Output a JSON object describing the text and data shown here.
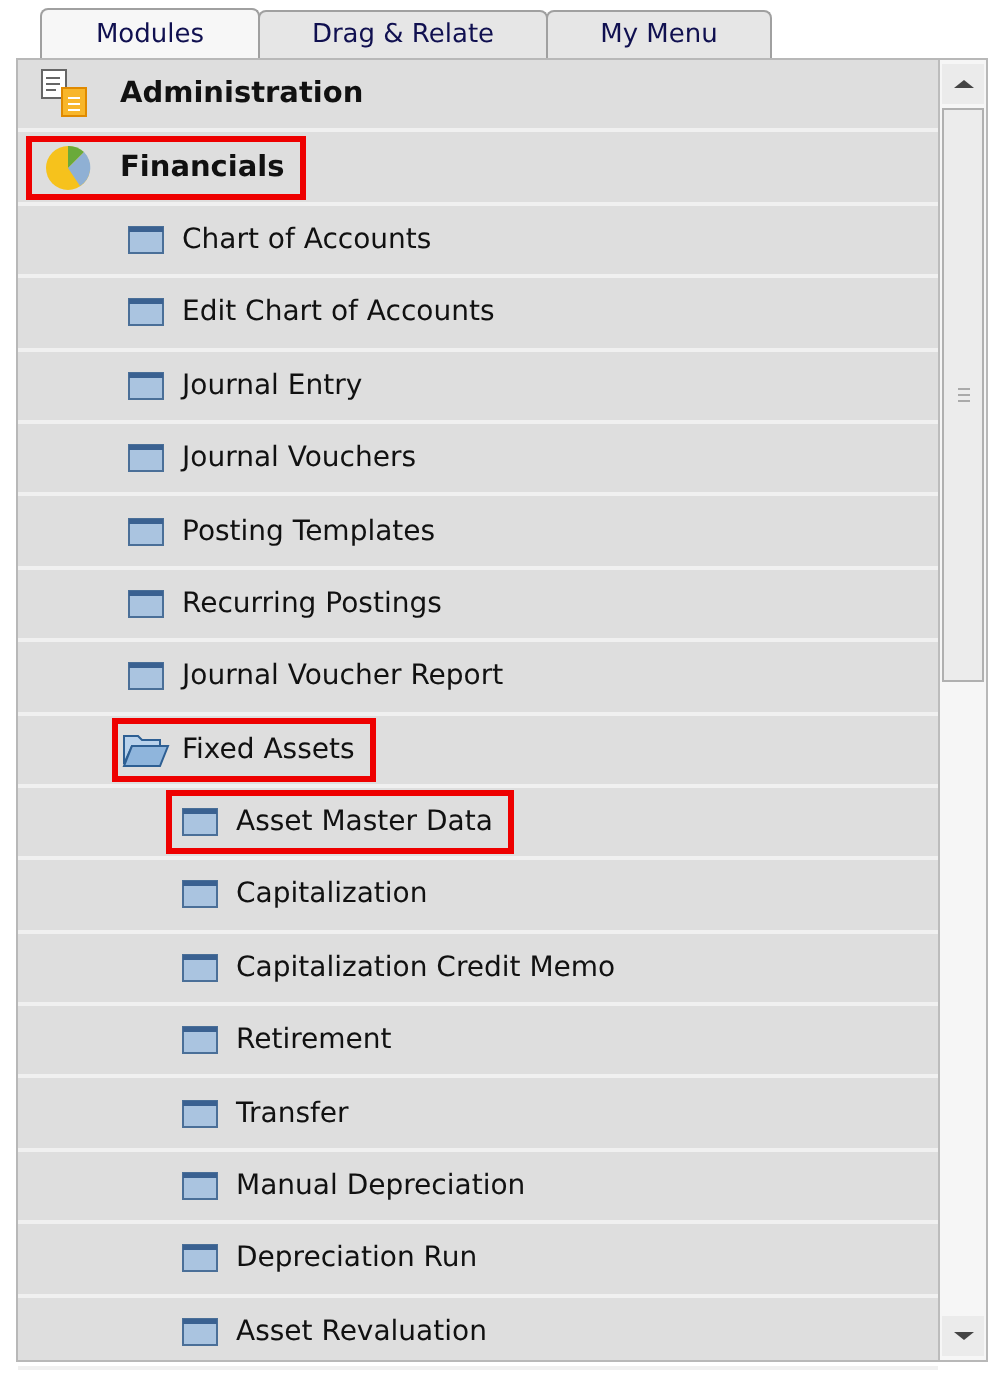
{
  "tabs": [
    {
      "label": "Modules",
      "selected": true
    },
    {
      "label": "Drag & Relate",
      "selected": false
    },
    {
      "label": "My Menu",
      "selected": false
    }
  ],
  "tree": [
    {
      "label": "Administration",
      "kind": "admin",
      "highlighted": false
    },
    {
      "label": "Financials",
      "kind": "financials",
      "highlighted": true,
      "children": [
        {
          "label": "Chart of Accounts",
          "kind": "window",
          "highlighted": false
        },
        {
          "label": "Edit Chart of Accounts",
          "kind": "window",
          "highlighted": false
        },
        {
          "label": "Journal Entry",
          "kind": "window",
          "highlighted": false
        },
        {
          "label": "Journal Vouchers",
          "kind": "window",
          "highlighted": false
        },
        {
          "label": "Posting Templates",
          "kind": "window",
          "highlighted": false
        },
        {
          "label": "Recurring Postings",
          "kind": "window",
          "highlighted": false
        },
        {
          "label": "Journal Voucher Report",
          "kind": "window",
          "highlighted": false
        },
        {
          "label": "Fixed Assets",
          "kind": "folder",
          "highlighted": true,
          "children": [
            {
              "label": "Asset Master Data",
              "kind": "window",
              "highlighted": true
            },
            {
              "label": "Capitalization",
              "kind": "window",
              "highlighted": false
            },
            {
              "label": "Capitalization Credit Memo",
              "kind": "window",
              "highlighted": false
            },
            {
              "label": "Retirement",
              "kind": "window",
              "highlighted": false
            },
            {
              "label": "Transfer",
              "kind": "window",
              "highlighted": false
            },
            {
              "label": "Manual Depreciation",
              "kind": "window",
              "highlighted": false
            },
            {
              "label": "Depreciation Run",
              "kind": "window",
              "highlighted": false
            },
            {
              "label": "Asset Revaluation",
              "kind": "window",
              "highlighted": false
            }
          ]
        }
      ]
    }
  ]
}
